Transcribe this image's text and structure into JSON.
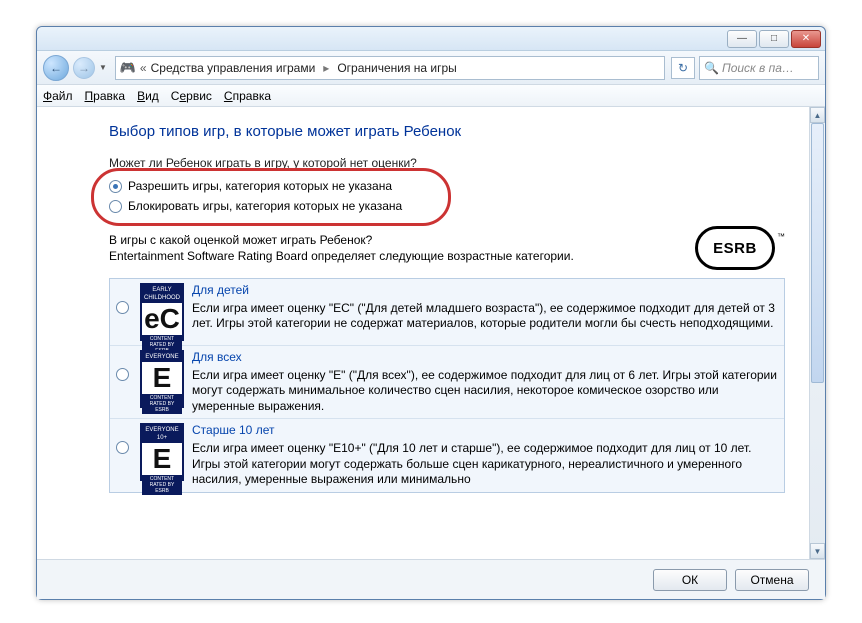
{
  "titlebar": {
    "minimize": "—",
    "maximize": "□",
    "close": "✕"
  },
  "nav": {
    "back_glyph": "←",
    "fwd_glyph": "→",
    "addr_prefix": "«",
    "addr_seg1": "Средства управления играми",
    "addr_sep": "▸",
    "addr_seg2": "Ограничения на игры",
    "refresh_glyph": "↻",
    "search_placeholder": "Поиск в па…",
    "search_icon": "🔍"
  },
  "menu": {
    "file": "Файл",
    "edit": "Правка",
    "view": "Вид",
    "tools": "Сервис",
    "help": "Справка"
  },
  "page": {
    "title": "Выбор типов игр, в которые может играть Ребенок",
    "q1": "Может ли Ребенок играть в игру, у которой нет оценки?",
    "radio_allow": "Разрешить игры, категория которых не указана",
    "radio_block": "Блокировать игры, категория которых не указана",
    "q2_line1": "В игры с какой оценкой может играть Ребенок?",
    "q2_line2": "Entertainment Software Rating Board определяет следующие возрастные категории.",
    "esrb": "ESRB",
    "esrb_tm": "™"
  },
  "ratings": [
    {
      "icon_top": "EARLY CHILDHOOD",
      "icon_letter": "eC",
      "icon_bot": "CONTENT RATED BY ESRB",
      "title": "Для детей",
      "desc": "Если игра имеет оценку \"EC\" (\"Для детей младшего возраста\"), ее содержимое подходит для детей от 3 лет.  Игры этой категории не содержат материалов, которые родители могли бы счесть неподходящими."
    },
    {
      "icon_top": "EVERYONE",
      "icon_letter": "E",
      "icon_bot": "CONTENT RATED BY ESRB",
      "title": "Для всех",
      "desc": "Если игра имеет оценку \"E\" (\"Для всех\"), ее содержимое подходит для лиц от 6 лет. Игры этой категории могут содержать минимальное количество сцен насилия, некоторое комическое озорство или умеренные выражения."
    },
    {
      "icon_top": "EVERYONE 10+",
      "icon_letter": "E",
      "icon_bot": "CONTENT RATED BY ESRB",
      "title": "Старше 10 лет",
      "desc": "Если игра имеет оценку \"E10+\" (\"Для 10 лет и старше\"), ее содержимое подходит для лиц от 10 лет. Игры этой категории могут содержать больше сцен карикатурного, нереалистичного и умеренного насилия, умеренные выражения или минимально"
    }
  ],
  "buttons": {
    "ok": "ОК",
    "cancel": "Отмена"
  }
}
